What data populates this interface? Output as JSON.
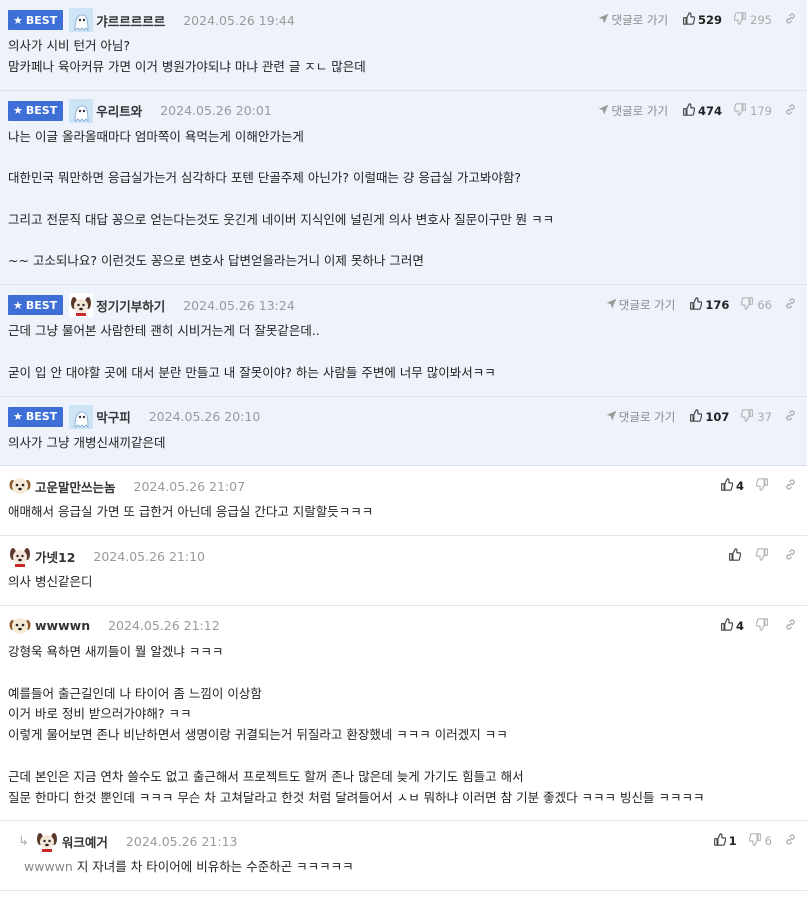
{
  "labels": {
    "best": "BEST",
    "goto": "댓글로 가기"
  },
  "colors": {
    "best_bg": "#eef2fb",
    "badge": "#3d6fd6"
  },
  "icons": {
    "best": "star-icon",
    "goto": "send-arrow-icon",
    "up": "thumbs-up-icon",
    "down": "thumbs-down-icon",
    "link": "link-icon",
    "reply": "reply-arrow-icon"
  },
  "comments": [
    {
      "best": true,
      "avatar": "ghost",
      "nick": "갸르르르르르",
      "date": "2024.05.26 19:44",
      "goto": true,
      "up": "529",
      "down": "295",
      "lines": [
        "의사가 시비 턴거 아님?",
        "맘카페나 육아커뮤 가면 이거 병원가야되냐 마냐 관련 글 ㅈㄴ 많은데"
      ]
    },
    {
      "best": true,
      "avatar": "ghost",
      "nick": "우리트와",
      "date": "2024.05.26 20:01",
      "goto": true,
      "up": "474",
      "down": "179",
      "lines": [
        "나는 이글 올라올때마다 엄마쪽이 욕먹는게 이해안가는게",
        "",
        "대한민국 뭐만하면 응급실가는거 심각하다 포텐 단골주제 아닌가? 이럴때는 걍 응급실 가고봐야함?",
        "",
        "그리고 전문직 대답 꽁으로 얻는다는것도 웃긴게 네이버 지식인에 널린게 의사 변호사 질문이구만 뭔 ㅋㅋ",
        "",
        "~~ 고소되나요? 이런것도 꽁으로 변호사 답변얻을라는거니 이제 못하나 그러면"
      ]
    },
    {
      "best": true,
      "avatar": "dog",
      "nick": "정기기부하기",
      "date": "2024.05.26 13:24",
      "goto": true,
      "up": "176",
      "down": "66",
      "lines": [
        "근데 그냥 물어본 사람한테 괜히 시비거는게 더 잘못같은데..",
        "",
        "굳이 입 안 대야할 곳에 대서 분란 만들고 내 잘못이야? 하는 사람들 주변에 너무 많이봐서ㅋㅋ"
      ]
    },
    {
      "best": true,
      "avatar": "ghost",
      "nick": "막구피",
      "date": "2024.05.26 20:10",
      "goto": true,
      "up": "107",
      "down": "37",
      "lines": [
        "의사가 그냥 개병신새끼같은데"
      ]
    },
    {
      "best": false,
      "avatar": "puppy",
      "nick": "고운말만쓰는놈",
      "date": "2024.05.26 21:07",
      "goto": false,
      "up": "4",
      "down": "",
      "lines": [
        "애매해서 응급실 가면 또 급한거 아닌데 응급실 간다고 지랄할듯ㅋㅋㅋ"
      ]
    },
    {
      "best": false,
      "avatar": "dog",
      "nick": "가넷12",
      "date": "2024.05.26 21:10",
      "goto": false,
      "up": "",
      "down": "",
      "lines": [
        "의사 병신같은디"
      ]
    },
    {
      "best": false,
      "avatar": "puppy",
      "nick": "wwwwn",
      "date": "2024.05.26 21:12",
      "goto": false,
      "up": "4",
      "down": "",
      "lines": [
        "강형욱 욕하면 새끼들이 뭘 알겠냐 ㅋㅋㅋ",
        "",
        "예를들어 출근길인데 나 타이어 좀 느낌이 이상함",
        "이거 바로 정비 받으러가야해? ㅋㅋ",
        "이렇게 물어보면 존나 비난하면서 생명이랑 귀결되는거 뒤질라고 환장했네 ㅋㅋㅋ 이러겠지 ㅋㅋ",
        "",
        "근데 본인은 지금 연차 쓸수도 없고 출근해서 프로젝트도 할꺼 존나 많은데 늦게 가기도 힘들고 해서",
        "질문 한마디 한것 뿐인데 ㅋㅋㅋ 무슨 차 고쳐달라고 한것 처럼 달려들어서 ㅅㅂ 뭐하냐 이러면 참 기분 좋겠다 ㅋㅋㅋ 빙신들 ㅋㅋㅋㅋ"
      ]
    },
    {
      "best": false,
      "reply": true,
      "avatar": "dog",
      "nick": "워크예거",
      "date": "2024.05.26 21:13",
      "goto": false,
      "up": "1",
      "down": "6",
      "mention": "wwwwn",
      "lines": [
        "지 자녀를 차 타이어에 비유하는 수준하곤 ㅋㅋㅋㅋㅋ"
      ]
    }
  ]
}
